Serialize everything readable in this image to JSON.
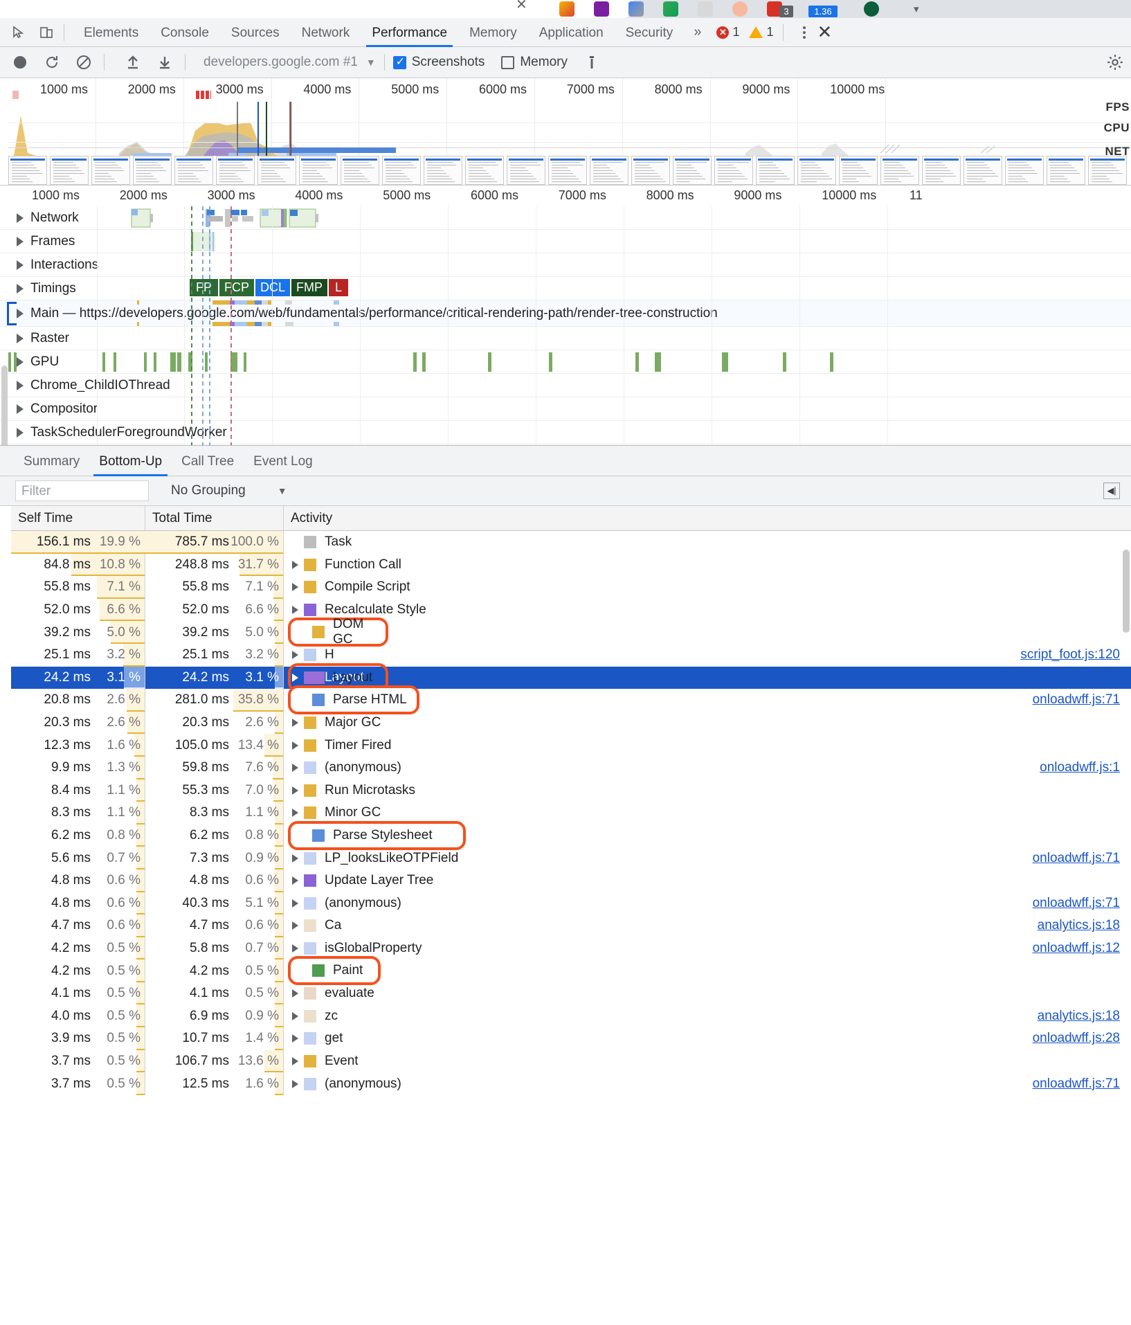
{
  "browser": {
    "badge_count": "3",
    "badge_version": "1.36"
  },
  "devtools": {
    "tabs": [
      {
        "label": "Elements",
        "active": false
      },
      {
        "label": "Console",
        "active": false
      },
      {
        "label": "Sources",
        "active": false
      },
      {
        "label": "Network",
        "active": false
      },
      {
        "label": "Performance",
        "active": true
      },
      {
        "label": "Memory",
        "active": false
      },
      {
        "label": "Application",
        "active": false
      },
      {
        "label": "Security",
        "active": false
      }
    ],
    "more_label": "»",
    "error_count": "1",
    "warning_count": "1",
    "close_label": "✕"
  },
  "record_toolbar": {
    "record_icon": "record-icon",
    "reload_icon": "reload-icon",
    "clear_icon": "clear-icon",
    "upload_icon": "upload-icon",
    "download_icon": "download-icon",
    "profile_name": "developers.google.com #1",
    "profile_caret": "▼",
    "screenshots_label": "Screenshots",
    "screenshots_checked": true,
    "memory_label": "Memory",
    "memory_checked": false,
    "trash_icon": "trash-icon",
    "settings_icon": "gear-icon"
  },
  "overview": {
    "ticks": [
      "1000 ms",
      "2000 ms",
      "3000 ms",
      "4000 ms",
      "5000 ms",
      "6000 ms",
      "7000 ms",
      "8000 ms",
      "9000 ms",
      "10000 ms"
    ],
    "side_labels": [
      "FPS",
      "CPU",
      "NET"
    ]
  },
  "flamechart": {
    "ticks": [
      "1000 ms",
      "2000 ms",
      "3000 ms",
      "4000 ms",
      "5000 ms",
      "6000 ms",
      "7000 ms",
      "8000 ms",
      "9000 ms",
      "10000 ms",
      "11"
    ],
    "tracks": [
      {
        "label": "Network"
      },
      {
        "label": "Frames"
      },
      {
        "label": "Interactions"
      },
      {
        "label": "Timings"
      },
      {
        "label": "Main — https://developers.google.com/web/fundamentals/performance/critical-rendering-path/render-tree-construction"
      },
      {
        "label": "Raster"
      },
      {
        "label": "GPU"
      },
      {
        "label": "Chrome_ChildIOThread"
      },
      {
        "label": "Compositor"
      },
      {
        "label": "TaskSchedulerForegroundWorker"
      }
    ],
    "timing_markers": [
      {
        "label": "FP",
        "color": "#2d6a33"
      },
      {
        "label": "FCP",
        "color": "#2d6a33"
      },
      {
        "label": "DCL",
        "color": "#1a73e8"
      },
      {
        "label": "FMP",
        "color": "#1c4a20"
      },
      {
        "label": "L",
        "color": "#b82424"
      }
    ]
  },
  "bottom_panel": {
    "tabs": [
      {
        "label": "Summary",
        "active": false
      },
      {
        "label": "Bottom-Up",
        "active": true
      },
      {
        "label": "Call Tree",
        "active": false
      },
      {
        "label": "Event Log",
        "active": false
      }
    ],
    "filter_placeholder": "Filter",
    "filter_value": "",
    "grouping_value": "No Grouping",
    "grouping_caret": "▼",
    "collapse_icon": "collapse-sidebar-icon",
    "columns": [
      "Self Time",
      "Total Time",
      "Activity"
    ],
    "rows": [
      {
        "self_ms": "156.1 ms",
        "self_pct": "19.9 %",
        "total_ms": "785.7 ms",
        "total_pct": "100.0 %",
        "activity": "Task",
        "color": "#bdbdbd",
        "expandable": false,
        "selected": false,
        "link": "",
        "annotated": false,
        "self_bar": 1.0,
        "total_bar": 1.0
      },
      {
        "self_ms": "84.8 ms",
        "self_pct": "10.8 %",
        "total_ms": "248.8 ms",
        "total_pct": "31.7 %",
        "activity": "Function Call",
        "color": "#e2b23c",
        "expandable": true,
        "selected": false,
        "link": "",
        "annotated": false,
        "self_bar": 0.545,
        "total_bar": 0.317
      },
      {
        "self_ms": "55.8 ms",
        "self_pct": "7.1 %",
        "total_ms": "55.8 ms",
        "total_pct": "7.1 %",
        "activity": "Compile Script",
        "color": "#e2b23c",
        "expandable": true,
        "selected": false,
        "link": "",
        "annotated": false,
        "self_bar": 0.358,
        "total_bar": 0.071
      },
      {
        "self_ms": "52.0 ms",
        "self_pct": "6.6 %",
        "total_ms": "52.0 ms",
        "total_pct": "6.6 %",
        "activity": "Recalculate Style",
        "color": "#8a64d6",
        "expandable": true,
        "selected": false,
        "link": "",
        "annotated": false,
        "self_bar": 0.334,
        "total_bar": 0.066
      },
      {
        "self_ms": "39.2 ms",
        "self_pct": "5.0 %",
        "total_ms": "39.2 ms",
        "total_pct": "5.0 %",
        "activity": "DOM GC",
        "color": "#e2b23c",
        "expandable": true,
        "selected": false,
        "link": "",
        "annotated": true,
        "self_bar": 0.252,
        "total_bar": 0.05
      },
      {
        "self_ms": "25.1 ms",
        "self_pct": "3.2 %",
        "total_ms": "25.1 ms",
        "total_pct": "3.2 %",
        "activity": "H",
        "color": "#bdd0f0",
        "expandable": true,
        "selected": false,
        "link": "script_foot.js:120",
        "annotated": false,
        "self_bar": 0.161,
        "total_bar": 0.032
      },
      {
        "self_ms": "24.2 ms",
        "self_pct": "3.1 %",
        "total_ms": "24.2 ms",
        "total_pct": "3.1 %",
        "activity": "Layout",
        "color": "#9a6fd8",
        "expandable": true,
        "selected": true,
        "link": "",
        "annotated": true,
        "self_bar": 0.155,
        "total_bar": 0.031
      },
      {
        "self_ms": "20.8 ms",
        "self_pct": "2.6 %",
        "total_ms": "281.0 ms",
        "total_pct": "35.8 %",
        "activity": "Parse HTML",
        "color": "#5b8dd9",
        "expandable": true,
        "selected": false,
        "link": "onloadwff.js:71",
        "annotated": true,
        "self_bar": 0.133,
        "total_bar": 0.358
      },
      {
        "self_ms": "20.3 ms",
        "self_pct": "2.6 %",
        "total_ms": "20.3 ms",
        "total_pct": "2.6 %",
        "activity": "Major GC",
        "color": "#e2b23c",
        "expandable": true,
        "selected": false,
        "link": "",
        "annotated": false,
        "self_bar": 0.13,
        "total_bar": 0.026
      },
      {
        "self_ms": "12.3 ms",
        "self_pct": "1.6 %",
        "total_ms": "105.0 ms",
        "total_pct": "13.4 %",
        "activity": "Timer Fired",
        "color": "#e2b23c",
        "expandable": true,
        "selected": false,
        "link": "",
        "annotated": false,
        "self_bar": 0.079,
        "total_bar": 0.134
      },
      {
        "self_ms": "9.9 ms",
        "self_pct": "1.3 %",
        "total_ms": "59.8 ms",
        "total_pct": "7.6 %",
        "activity": "(anonymous)",
        "color": "#c5d2f2",
        "expandable": true,
        "selected": false,
        "link": "onloadwff.js:1",
        "annotated": false,
        "self_bar": 0.064,
        "total_bar": 0.076
      },
      {
        "self_ms": "8.4 ms",
        "self_pct": "1.1 %",
        "total_ms": "55.3 ms",
        "total_pct": "7.0 %",
        "activity": "Run Microtasks",
        "color": "#e2b23c",
        "expandable": true,
        "selected": false,
        "link": "",
        "annotated": false,
        "self_bar": 0.054,
        "total_bar": 0.07
      },
      {
        "self_ms": "8.3 ms",
        "self_pct": "1.1 %",
        "total_ms": "8.3 ms",
        "total_pct": "1.1 %",
        "activity": "Minor GC",
        "color": "#e2b23c",
        "expandable": true,
        "selected": false,
        "link": "",
        "annotated": false,
        "self_bar": 0.053,
        "total_bar": 0.011
      },
      {
        "self_ms": "6.2 ms",
        "self_pct": "0.8 %",
        "total_ms": "6.2 ms",
        "total_pct": "0.8 %",
        "activity": "Parse Stylesheet",
        "color": "#5b8dd9",
        "expandable": true,
        "selected": false,
        "link": "",
        "annotated": true,
        "self_bar": 0.04,
        "total_bar": 0.008
      },
      {
        "self_ms": "5.6 ms",
        "self_pct": "0.7 %",
        "total_ms": "7.3 ms",
        "total_pct": "0.9 %",
        "activity": "LP_looksLikeOTPField",
        "color": "#c5d2f2",
        "expandable": true,
        "selected": false,
        "link": "onloadwff.js:71",
        "annotated": false,
        "self_bar": 0.036,
        "total_bar": 0.009
      },
      {
        "self_ms": "4.8 ms",
        "self_pct": "0.6 %",
        "total_ms": "4.8 ms",
        "total_pct": "0.6 %",
        "activity": "Update Layer Tree",
        "color": "#8a64d6",
        "expandable": true,
        "selected": false,
        "link": "",
        "annotated": false,
        "self_bar": 0.031,
        "total_bar": 0.006
      },
      {
        "self_ms": "4.8 ms",
        "self_pct": "0.6 %",
        "total_ms": "40.3 ms",
        "total_pct": "5.1 %",
        "activity": "(anonymous)",
        "color": "#c5d2f2",
        "expandable": true,
        "selected": false,
        "link": "onloadwff.js:71",
        "annotated": false,
        "self_bar": 0.031,
        "total_bar": 0.051
      },
      {
        "self_ms": "4.7 ms",
        "self_pct": "0.6 %",
        "total_ms": "4.7 ms",
        "total_pct": "0.6 %",
        "activity": "Ca",
        "color": "#ece0cc",
        "expandable": true,
        "selected": false,
        "link": "analytics.js:18",
        "annotated": false,
        "self_bar": 0.03,
        "total_bar": 0.006
      },
      {
        "self_ms": "4.2 ms",
        "self_pct": "0.5 %",
        "total_ms": "5.8 ms",
        "total_pct": "0.7 %",
        "activity": "isGlobalProperty",
        "color": "#c5d2f2",
        "expandable": true,
        "selected": false,
        "link": "onloadwff.js:12",
        "annotated": false,
        "self_bar": 0.027,
        "total_bar": 0.007
      },
      {
        "self_ms": "4.2 ms",
        "self_pct": "0.5 %",
        "total_ms": "4.2 ms",
        "total_pct": "0.5 %",
        "activity": "Paint",
        "color": "#4f9b4f",
        "expandable": true,
        "selected": false,
        "link": "",
        "annotated": true,
        "self_bar": 0.027,
        "total_bar": 0.005
      },
      {
        "self_ms": "4.1 ms",
        "self_pct": "0.5 %",
        "total_ms": "4.1 ms",
        "total_pct": "0.5 %",
        "activity": "evaluate",
        "color": "#e8d8c8",
        "expandable": true,
        "selected": false,
        "link": "",
        "annotated": false,
        "self_bar": 0.026,
        "total_bar": 0.005
      },
      {
        "self_ms": "4.0 ms",
        "self_pct": "0.5 %",
        "total_ms": "6.9 ms",
        "total_pct": "0.9 %",
        "activity": "zc",
        "color": "#ece0cc",
        "expandable": true,
        "selected": false,
        "link": "analytics.js:18",
        "annotated": false,
        "self_bar": 0.026,
        "total_bar": 0.009
      },
      {
        "self_ms": "3.9 ms",
        "self_pct": "0.5 %",
        "total_ms": "10.7 ms",
        "total_pct": "1.4 %",
        "activity": "get",
        "color": "#c5d2f2",
        "expandable": true,
        "selected": false,
        "link": "onloadwff.js:28",
        "annotated": false,
        "self_bar": 0.025,
        "total_bar": 0.014
      },
      {
        "self_ms": "3.7 ms",
        "self_pct": "0.5 %",
        "total_ms": "106.7 ms",
        "total_pct": "13.6 %",
        "activity": "Event",
        "color": "#e2b23c",
        "expandable": true,
        "selected": false,
        "link": "",
        "annotated": false,
        "self_bar": 0.024,
        "total_bar": 0.136
      },
      {
        "self_ms": "3.7 ms",
        "self_pct": "0.5 %",
        "total_ms": "12.5 ms",
        "total_pct": "1.6 %",
        "activity": "(anonymous)",
        "color": "#c5d2f2",
        "expandable": true,
        "selected": false,
        "link": "onloadwff.js:71",
        "annotated": false,
        "self_bar": 0.024,
        "total_bar": 0.016
      }
    ]
  }
}
